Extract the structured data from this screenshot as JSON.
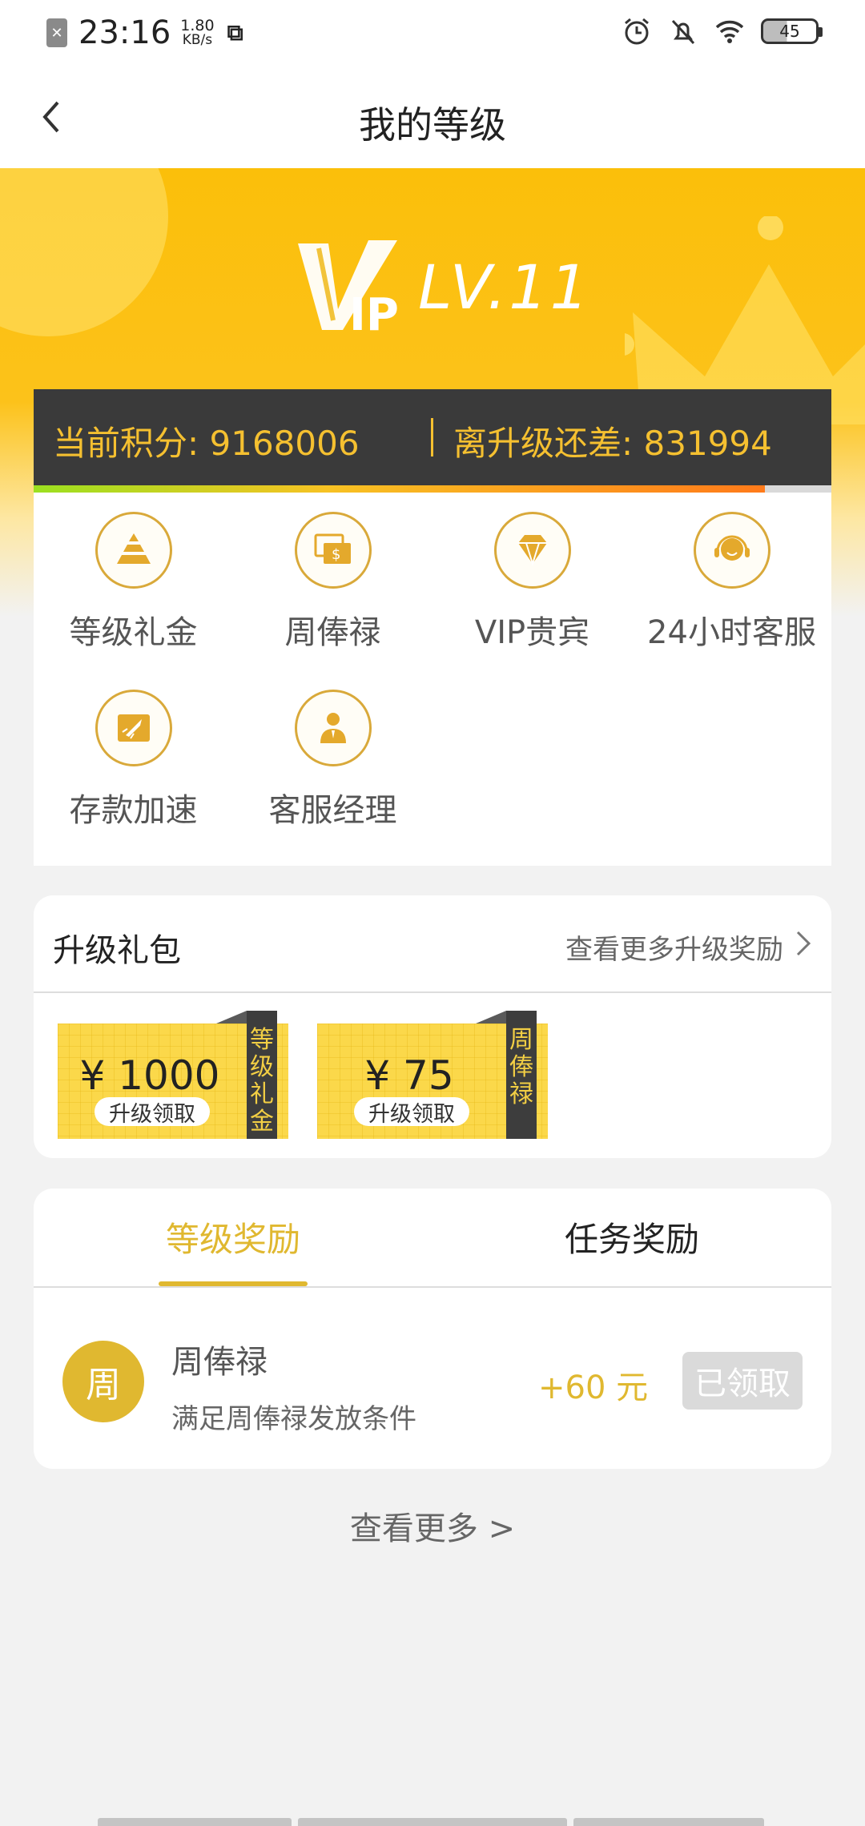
{
  "status_bar": {
    "time": "23:16",
    "speed_value": "1.80",
    "speed_unit": "KB/s",
    "battery": "45"
  },
  "header": {
    "title": "我的等级"
  },
  "hero": {
    "vip_logo_text": "VIP",
    "level": "LV.11"
  },
  "points": {
    "current_label": "当前积分: 9168006",
    "remaining_label": "离升级还差: 831994",
    "progress": 0.917
  },
  "benefits": [
    {
      "label": "等级礼金",
      "icon": "pyramid-icon"
    },
    {
      "label": "周俸禄",
      "icon": "salary-envelope-icon"
    },
    {
      "label": "VIP贵宾",
      "icon": "diamond-icon"
    },
    {
      "label": "24小时客服",
      "icon": "headset-agent-icon"
    },
    {
      "label": "存款加速",
      "icon": "rocket-icon"
    },
    {
      "label": "客服经理",
      "icon": "manager-icon"
    }
  ],
  "upgrade_package": {
    "title": "升级礼包",
    "more_link": "查看更多升级奖励",
    "coupons": [
      {
        "amount": "¥ 1000",
        "button": "升级领取",
        "ribbon": "等级礼金"
      },
      {
        "amount": "¥ 75",
        "button": "升级领取",
        "ribbon": "周俸禄"
      }
    ]
  },
  "rewards": {
    "tabs": [
      "等级奖励",
      "任务奖励"
    ],
    "active_tab": 0,
    "item": {
      "avatar_text": "周",
      "name": "周俸禄",
      "description": "满足周俸禄发放条件",
      "amount": "+60 元",
      "status_button": "已领取"
    }
  },
  "footer": {
    "see_more": "查看更多 >"
  },
  "colors": {
    "gold": "#e0b830",
    "hero_yellow": "#fbbf0a",
    "dark_bar": "#3a3a3a",
    "points_text": "#f5c030"
  }
}
